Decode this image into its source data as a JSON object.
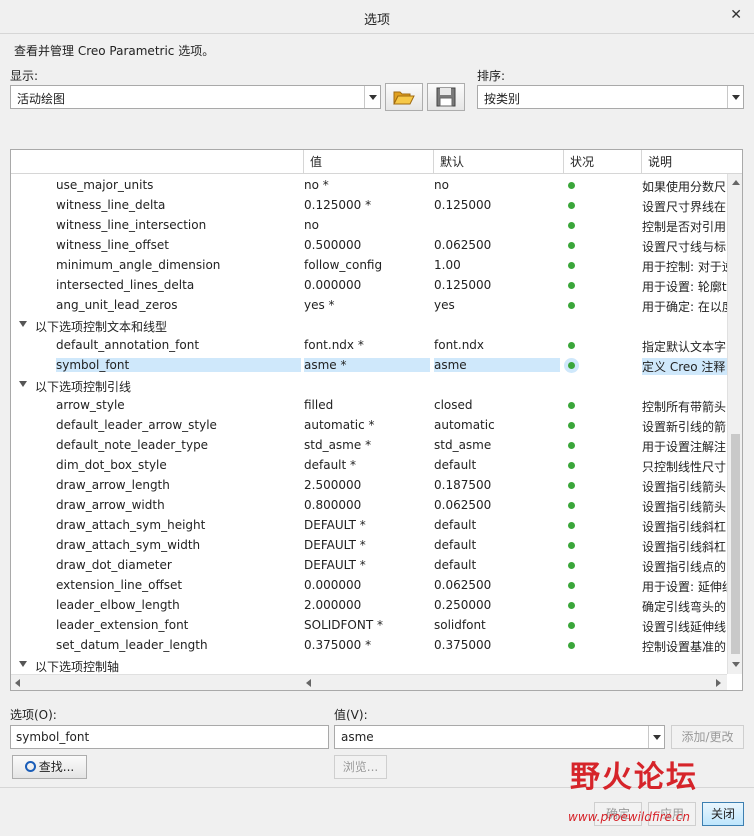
{
  "window": {
    "title": "选项"
  },
  "description": "查看并管理 Creo Parametric 选项。",
  "display": {
    "label": "显示:",
    "value": "活动绘图"
  },
  "sort": {
    "label": "排序:",
    "value": "按类别"
  },
  "icons": {
    "open": "folder-open-icon",
    "save": "floppy-save-icon",
    "close": "close-icon",
    "search": "magnifier-icon"
  },
  "table": {
    "headers": [
      "值",
      "默认",
      "状况",
      "说明"
    ],
    "rows": [
      {
        "type": "opt",
        "name": "use_major_units",
        "value": "no *",
        "default": "no",
        "desc": "如果使用分数尺"
      },
      {
        "type": "opt",
        "name": "witness_line_delta",
        "value": "0.125000 *",
        "default": "0.125000",
        "desc": "设置尺寸界线在"
      },
      {
        "type": "opt",
        "name": "witness_line_intersection",
        "value": "no",
        "default": "",
        "desc": "控制是否对引用"
      },
      {
        "type": "opt",
        "name": "witness_line_offset",
        "value": "0.500000",
        "default": "0.062500",
        "desc": "设置尺寸线与标"
      },
      {
        "type": "opt",
        "name": "minimum_angle_dimension",
        "value": "follow_config",
        "default": "1.00",
        "desc": "用于控制: 对于逆"
      },
      {
        "type": "opt",
        "name": "intersected_lines_delta",
        "value": "0.000000",
        "default": "0.125000",
        "desc": "用于设置: 轮廓t"
      },
      {
        "type": "opt",
        "name": "ang_unit_lead_zeros",
        "value": "yes *",
        "default": "yes",
        "desc": "用于确定: 在以度"
      },
      {
        "type": "group",
        "name": "以下选项控制文本和线型"
      },
      {
        "type": "opt",
        "name": "default_annotation_font",
        "value": "font.ndx *",
        "default": "font.ndx",
        "desc": "指定默认文本字"
      },
      {
        "type": "opt",
        "name": "symbol_font",
        "value": "asme *",
        "default": "asme",
        "desc": "定义 Creo 注释",
        "selected": true
      },
      {
        "type": "group",
        "name": "以下选项控制引线"
      },
      {
        "type": "opt",
        "name": "arrow_style",
        "value": "filled",
        "default": "closed",
        "desc": "控制所有带箭头"
      },
      {
        "type": "opt",
        "name": "default_leader_arrow_style",
        "value": "automatic *",
        "default": "automatic",
        "desc": "设置新引线的箭"
      },
      {
        "type": "opt",
        "name": "default_note_leader_type",
        "value": "std_asme *",
        "default": "std_asme",
        "desc": "用于设置注解注"
      },
      {
        "type": "opt",
        "name": "dim_dot_box_style",
        "value": "default *",
        "default": "default",
        "desc": "只控制线性尺寸"
      },
      {
        "type": "opt",
        "name": "draw_arrow_length",
        "value": "2.500000",
        "default": "0.187500",
        "desc": "设置指引线箭头"
      },
      {
        "type": "opt",
        "name": "draw_arrow_width",
        "value": "0.800000",
        "default": "0.062500",
        "desc": "设置指引线箭头"
      },
      {
        "type": "opt",
        "name": "draw_attach_sym_height",
        "value": "DEFAULT *",
        "default": "default",
        "desc": "设置指引线斜杠"
      },
      {
        "type": "opt",
        "name": "draw_attach_sym_width",
        "value": "DEFAULT *",
        "default": "default",
        "desc": "设置指引线斜杠"
      },
      {
        "type": "opt",
        "name": "draw_dot_diameter",
        "value": "DEFAULT *",
        "default": "default",
        "desc": "设置指引线点的"
      },
      {
        "type": "opt",
        "name": "extension_line_offset",
        "value": "0.000000",
        "default": "0.062500",
        "desc": "用于设置: 延伸线"
      },
      {
        "type": "opt",
        "name": "leader_elbow_length",
        "value": "2.000000",
        "default": "0.250000",
        "desc": "确定引线弯头的"
      },
      {
        "type": "opt",
        "name": "leader_extension_font",
        "value": "SOLIDFONT *",
        "default": "solidfont",
        "desc": "设置引线延伸线"
      },
      {
        "type": "opt",
        "name": "set_datum_leader_length",
        "value": "0.375000 *",
        "default": "0.375000",
        "desc": "控制设置基准的"
      },
      {
        "type": "group",
        "name": "以下选项控制轴"
      }
    ]
  },
  "option": {
    "label": "选项(O):",
    "value": "symbol_font"
  },
  "value": {
    "label": "值(V):",
    "value": "asme"
  },
  "buttons": {
    "add_change": "添加/更改",
    "find": "查找...",
    "browse": "浏览...",
    "ok": "确定",
    "apply": "应用",
    "close": "关闭"
  },
  "watermark": {
    "text": "野火论坛",
    "url": "www.proewildfire.cn"
  },
  "colors": {
    "status_ok": "#3aa63a",
    "selection": "#cfe8fb",
    "brand_red": "#d6242a"
  }
}
